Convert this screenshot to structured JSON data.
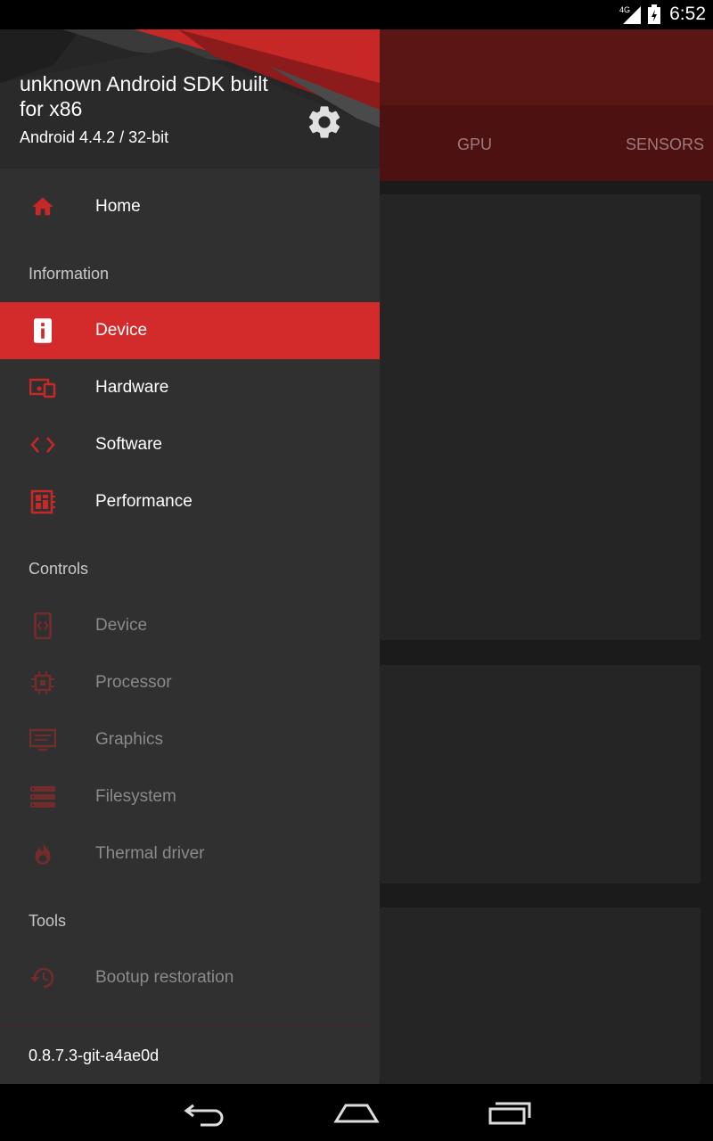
{
  "status": {
    "network": "4G",
    "time": "6:52"
  },
  "background": {
    "tabs": [
      "GPU",
      "SENSORS"
    ]
  },
  "drawer": {
    "device_name": "unknown Android SDK built for x86",
    "device_info": "Android 4.4.2 / 32-bit",
    "home": "Home",
    "sections": {
      "information": "Information",
      "controls": "Controls",
      "tools": "Tools"
    },
    "information_items": [
      "Device",
      "Hardware",
      "Software",
      "Performance"
    ],
    "controls_items": [
      "Device",
      "Processor",
      "Graphics",
      "Filesystem",
      "Thermal driver"
    ],
    "tools_items": [
      "Bootup restoration"
    ],
    "version": "0.8.7.3-git-a4ae0d"
  },
  "colors": {
    "accent": "#d32b2b",
    "icon_red": "#c62828",
    "drawer_bg": "#303030"
  }
}
